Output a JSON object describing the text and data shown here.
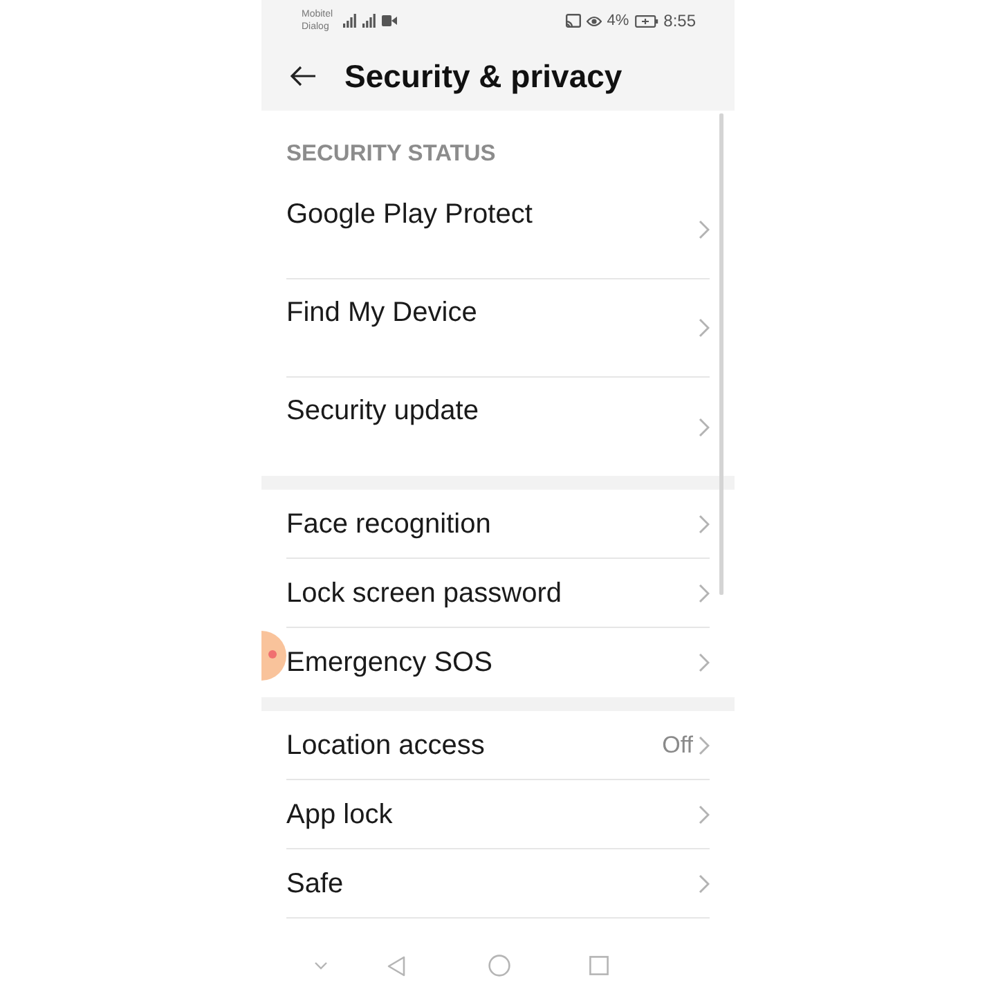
{
  "status_bar": {
    "carriers": [
      "Mobitel",
      "Dialog"
    ],
    "battery": "4%",
    "time": "8:55"
  },
  "header": {
    "title": "Security & privacy"
  },
  "sections": [
    {
      "title": "SECURITY STATUS",
      "items": [
        {
          "kind": "tall",
          "label": "Google Play Protect"
        },
        {
          "kind": "tall",
          "label": "Find My Device"
        },
        {
          "kind": "tall",
          "label": "Security update"
        }
      ]
    },
    {
      "items": [
        {
          "kind": "row",
          "label": "Face recognition"
        },
        {
          "kind": "row",
          "label": "Lock screen password"
        },
        {
          "kind": "row",
          "label": "Emergency SOS"
        }
      ]
    },
    {
      "items": [
        {
          "kind": "row",
          "label": "Location access",
          "value": "Off"
        },
        {
          "kind": "row",
          "label": "App lock"
        },
        {
          "kind": "row",
          "label": "Safe"
        }
      ]
    }
  ]
}
